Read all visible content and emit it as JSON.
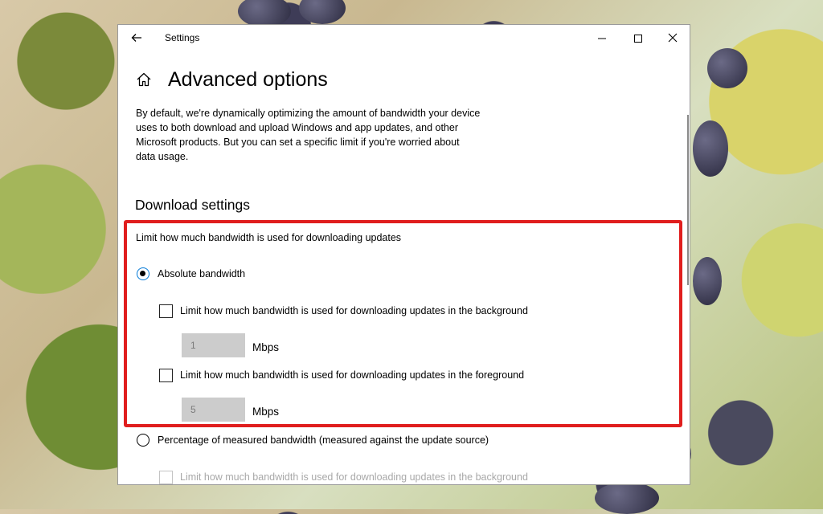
{
  "window": {
    "title": "Settings",
    "back_icon": "arrow-left-icon",
    "minimize_icon": "minimize-icon",
    "maximize_icon": "maximize-icon",
    "close_icon": "close-icon"
  },
  "page": {
    "home_icon": "home-icon",
    "title": "Advanced options",
    "description": "By default, we're dynamically optimizing the amount of bandwidth your device uses to both download and upload Windows and app updates, and other Microsoft products. But you can set a specific limit if you're worried about data usage."
  },
  "download_settings": {
    "heading": "Download settings",
    "limit_label": "Limit how much bandwidth is used for downloading updates",
    "absolute": {
      "label": "Absolute bandwidth",
      "selected": true,
      "background": {
        "label": "Limit how much bandwidth is used for downloading updates in the background",
        "checked": false,
        "value": "1",
        "unit": "Mbps"
      },
      "foreground": {
        "label": "Limit how much bandwidth is used for downloading updates in the foreground",
        "checked": false,
        "value": "5",
        "unit": "Mbps"
      }
    },
    "percentage": {
      "label": "Percentage of measured bandwidth (measured against the update source)",
      "selected": false,
      "background": {
        "label": "Limit how much bandwidth is used for downloading updates in the background",
        "checked": false,
        "disabled": true
      }
    }
  },
  "colors": {
    "highlight": "#e01e1e",
    "accent": "#0078d7"
  }
}
